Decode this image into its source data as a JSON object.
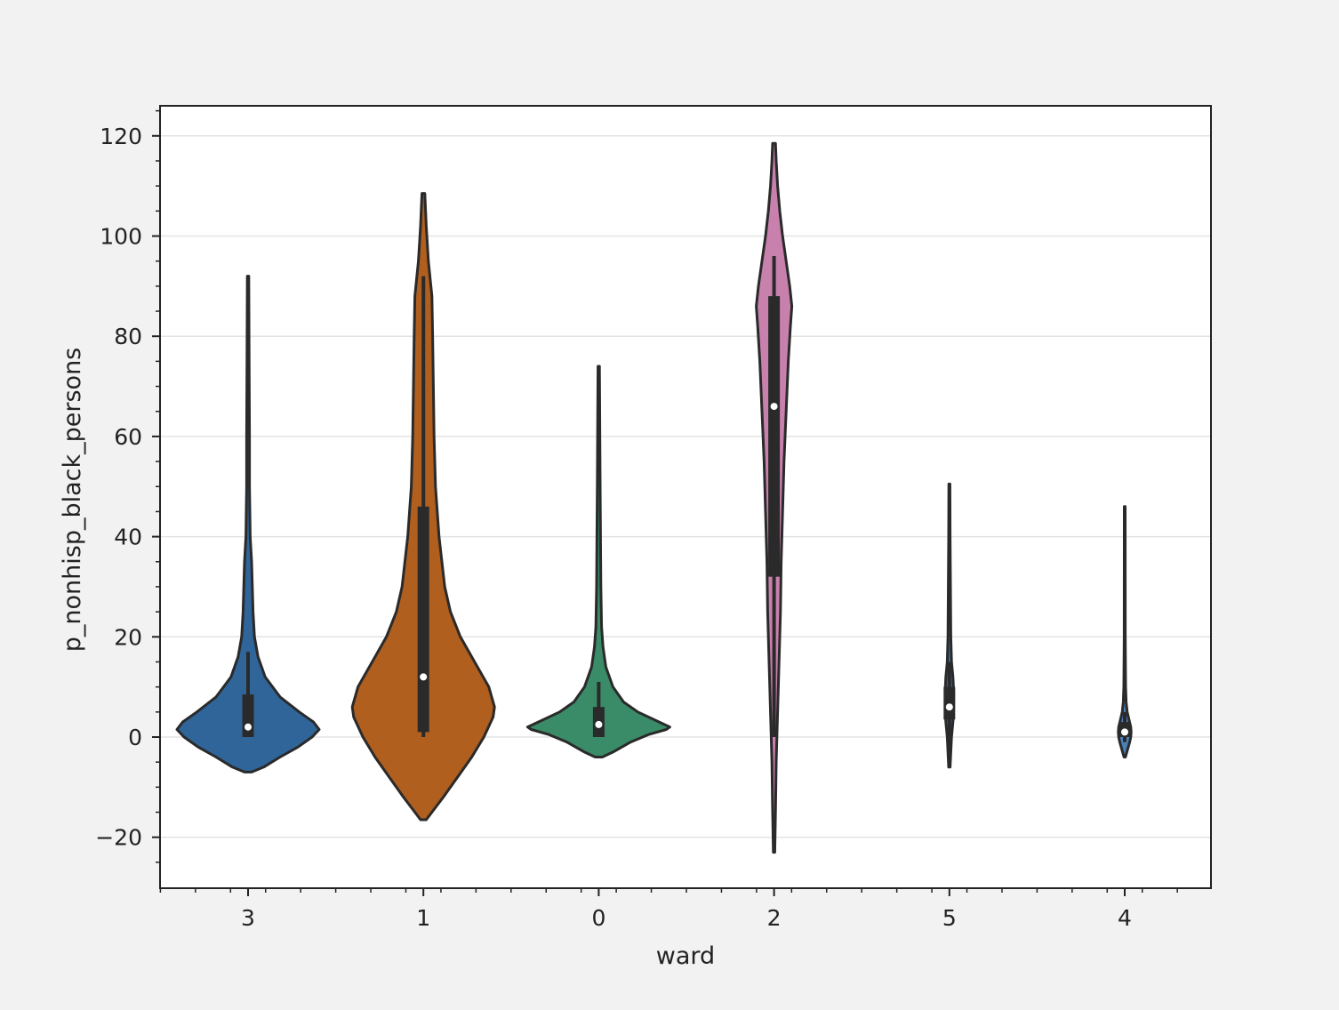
{
  "chart_data": {
    "type": "violin",
    "xlabel": "ward",
    "ylabel": "p_nonhisp_black_persons",
    "ylim": [
      -30,
      126
    ],
    "yticks": [
      -20,
      0,
      20,
      40,
      60,
      80,
      100,
      120
    ],
    "ytick_labels": [
      "−20",
      "0",
      "20",
      "40",
      "60",
      "80",
      "100",
      "120"
    ],
    "grid": true,
    "categories": [
      "3",
      "1",
      "0",
      "2",
      "5",
      "4"
    ],
    "colors": [
      "#30659a",
      "#b05f1f",
      "#3a8b67",
      "#c880ad",
      "#3f6fa8",
      "#4a7fb8"
    ],
    "violins": [
      {
        "category": "3",
        "range": [
          -7,
          92
        ],
        "q1": 0,
        "median": 2,
        "q3": 8.5,
        "whisker_low": 0,
        "whisker_high": 17,
        "profile": [
          [
            -7,
            0.05
          ],
          [
            -6,
            0.22
          ],
          [
            -4,
            0.45
          ],
          [
            -2,
            0.7
          ],
          [
            0,
            0.9
          ],
          [
            1.5,
            1.0
          ],
          [
            3,
            0.92
          ],
          [
            5,
            0.72
          ],
          [
            8,
            0.45
          ],
          [
            12,
            0.24
          ],
          [
            16,
            0.14
          ],
          [
            20,
            0.09
          ],
          [
            25,
            0.07
          ],
          [
            30,
            0.06
          ],
          [
            35,
            0.05
          ],
          [
            40,
            0.03
          ],
          [
            50,
            0.02
          ],
          [
            60,
            0.02
          ],
          [
            75,
            0.015
          ],
          [
            92,
            0.01
          ]
        ]
      },
      {
        "category": "1",
        "range": [
          -16.5,
          108.5
        ],
        "q1": 1,
        "median": 12,
        "q3": 46,
        "whisker_low": 0,
        "whisker_high": 92,
        "profile": [
          [
            -16.5,
            0.04
          ],
          [
            -15,
            0.12
          ],
          [
            -12,
            0.28
          ],
          [
            -8,
            0.48
          ],
          [
            -4,
            0.68
          ],
          [
            0,
            0.85
          ],
          [
            4,
            0.98
          ],
          [
            6,
            1.0
          ],
          [
            10,
            0.92
          ],
          [
            15,
            0.72
          ],
          [
            20,
            0.52
          ],
          [
            25,
            0.38
          ],
          [
            30,
            0.3
          ],
          [
            40,
            0.22
          ],
          [
            50,
            0.17
          ],
          [
            60,
            0.15
          ],
          [
            70,
            0.14
          ],
          [
            80,
            0.13
          ],
          [
            88,
            0.12
          ],
          [
            95,
            0.07
          ],
          [
            102,
            0.04
          ],
          [
            108.5,
            0.02
          ]
        ]
      },
      {
        "category": "0",
        "range": [
          -4,
          74
        ],
        "q1": 0,
        "median": 2.5,
        "q3": 6,
        "whisker_low": 0,
        "whisker_high": 11,
        "profile": [
          [
            -4,
            0.05
          ],
          [
            -3,
            0.2
          ],
          [
            -1,
            0.45
          ],
          [
            0.5,
            0.7
          ],
          [
            1.5,
            0.95
          ],
          [
            2,
            1.0
          ],
          [
            3,
            0.85
          ],
          [
            5,
            0.55
          ],
          [
            7,
            0.35
          ],
          [
            10,
            0.2
          ],
          [
            14,
            0.1
          ],
          [
            18,
            0.06
          ],
          [
            22,
            0.04
          ],
          [
            30,
            0.03
          ],
          [
            50,
            0.02
          ],
          [
            74,
            0.01
          ]
        ]
      },
      {
        "category": "2",
        "range": [
          -23,
          118.5
        ],
        "q1": 32,
        "median": 66,
        "q3": 88,
        "whisker_low": 0,
        "whisker_high": 96,
        "profile": [
          [
            -23,
            0.01
          ],
          [
            -15,
            0.02
          ],
          [
            -5,
            0.03
          ],
          [
            5,
            0.05
          ],
          [
            15,
            0.07
          ],
          [
            25,
            0.09
          ],
          [
            35,
            0.1
          ],
          [
            45,
            0.12
          ],
          [
            55,
            0.14
          ],
          [
            65,
            0.17
          ],
          [
            75,
            0.2
          ],
          [
            82,
            0.23
          ],
          [
            86,
            0.25
          ],
          [
            90,
            0.22
          ],
          [
            95,
            0.17
          ],
          [
            100,
            0.12
          ],
          [
            105,
            0.08
          ],
          [
            110,
            0.05
          ],
          [
            115,
            0.03
          ],
          [
            118.5,
            0.02
          ]
        ]
      },
      {
        "category": "5",
        "range": [
          -6,
          50.5
        ],
        "q1": 3.5,
        "median": 6,
        "q3": 10,
        "whisker_low": -3,
        "whisker_high": 15,
        "profile": [
          [
            -6,
            0.01
          ],
          [
            -3,
            0.02
          ],
          [
            0,
            0.03
          ],
          [
            3,
            0.05
          ],
          [
            6,
            0.06
          ],
          [
            9,
            0.06
          ],
          [
            12,
            0.05
          ],
          [
            15,
            0.03
          ],
          [
            20,
            0.02
          ],
          [
            30,
            0.015
          ],
          [
            40,
            0.01
          ],
          [
            50.5,
            0.008
          ]
        ]
      },
      {
        "category": "4",
        "range": [
          -4,
          46
        ],
        "q1": 0,
        "median": 1,
        "q3": 3,
        "whisker_low": -1,
        "whisker_high": 5,
        "profile": [
          [
            -4,
            0.01
          ],
          [
            -2.5,
            0.04
          ],
          [
            -1,
            0.07
          ],
          [
            0,
            0.085
          ],
          [
            1,
            0.09
          ],
          [
            2,
            0.085
          ],
          [
            3.5,
            0.06
          ],
          [
            5,
            0.035
          ],
          [
            7,
            0.02
          ],
          [
            10,
            0.012
          ],
          [
            20,
            0.008
          ],
          [
            46,
            0.006
          ]
        ]
      }
    ]
  }
}
